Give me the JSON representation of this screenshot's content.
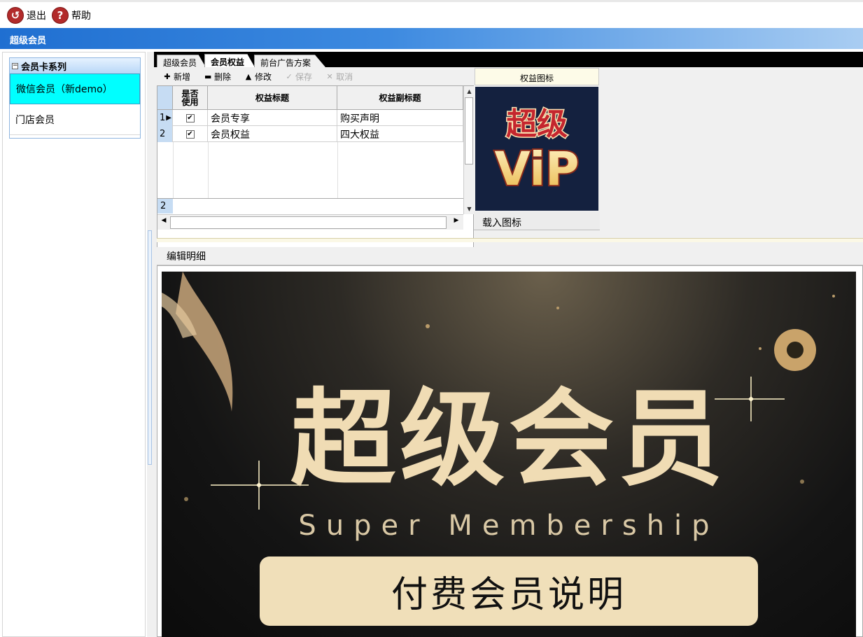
{
  "toolbar": {
    "exit_label": "退出",
    "help_label": "帮助"
  },
  "window": {
    "title": "超级会员"
  },
  "tree": {
    "header": "会员卡系列",
    "items": [
      {
        "label": "微信会员（新demo）",
        "selected": true
      },
      {
        "label": "门店会员",
        "selected": false
      }
    ]
  },
  "tabs": [
    {
      "label": "超级会员",
      "active": false
    },
    {
      "label": "会员权益",
      "active": true
    },
    {
      "label": "前台广告方案",
      "active": false
    }
  ],
  "edit_toolbar": {
    "add": "新增",
    "delete": "删除",
    "modify": "修改",
    "save": "保存",
    "cancel": "取消"
  },
  "grid": {
    "columns": [
      "是否使用",
      "权益标题",
      "权益副标题"
    ],
    "rows": [
      {
        "index": "1",
        "used": true,
        "title": "会员专享",
        "subtitle": "购买声明"
      },
      {
        "index": "2",
        "used": true,
        "title": "会员权益",
        "subtitle": "四大权益"
      }
    ],
    "footer_count": "2"
  },
  "icon_panel": {
    "header": "权益图标",
    "image_text_top": "超级",
    "image_text_bottom": "ViP",
    "load_label": "载入图标"
  },
  "detail": {
    "label": "编辑明细",
    "banner_title": "超级会员",
    "banner_subtitle": "Super Membership",
    "banner_button": "付费会员说明"
  },
  "colors": {
    "titlebar_start": "#1f6fd1",
    "selected_item": "#00ffff",
    "banner_gold": "#f0dcb4",
    "banner_button": "#f0dfb9"
  }
}
